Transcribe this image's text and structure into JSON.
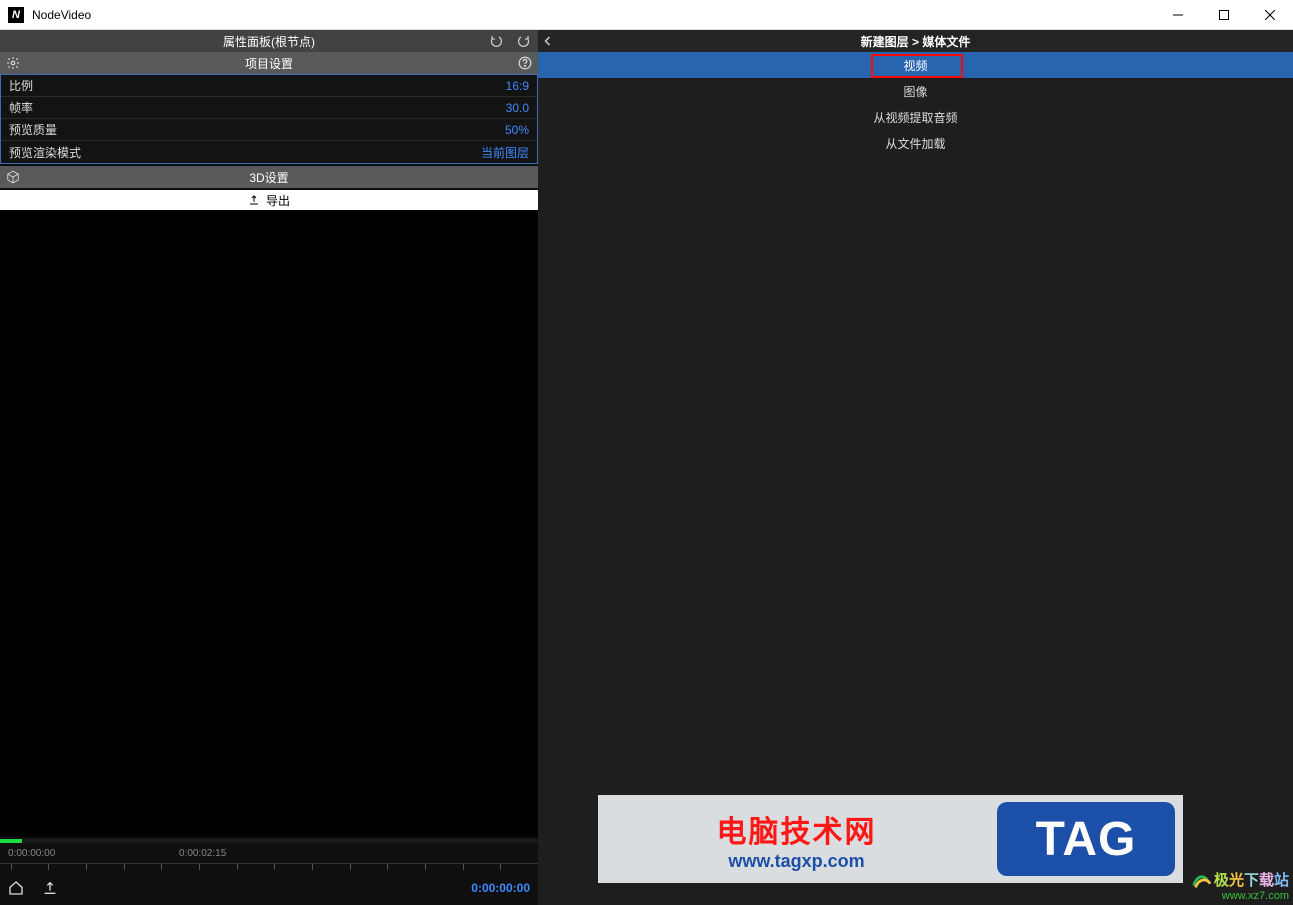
{
  "window": {
    "title": "NodeVideo"
  },
  "left": {
    "header_title": "属性面板(根节点)",
    "project_settings_label": "项目设置",
    "props": [
      {
        "label": "比例",
        "value": "16:9"
      },
      {
        "label": "帧率",
        "value": "30.0"
      },
      {
        "label": "预览质量",
        "value": "50%"
      },
      {
        "label": "预览渲染模式",
        "value": "当前图层"
      }
    ],
    "settings_3d_label": "3D设置",
    "export_label": "导出",
    "timeline": {
      "start_time": "0:00:00:00",
      "mid_time": "0:00:02:15",
      "playhead_time": "0:00:00:00"
    }
  },
  "right": {
    "breadcrumb": "新建图层 > 媒体文件",
    "items": [
      {
        "label": "视频",
        "selected": true
      },
      {
        "label": "图像",
        "selected": false
      },
      {
        "label": "从视频提取音频",
        "selected": false
      },
      {
        "label": "从文件加载",
        "selected": false
      }
    ]
  },
  "watermark1": {
    "title": "电脑技术网",
    "url": "www.tagxp.com",
    "tag": "TAG"
  },
  "watermark2": {
    "text": "极光下载站",
    "url": "www.xz7.com"
  }
}
